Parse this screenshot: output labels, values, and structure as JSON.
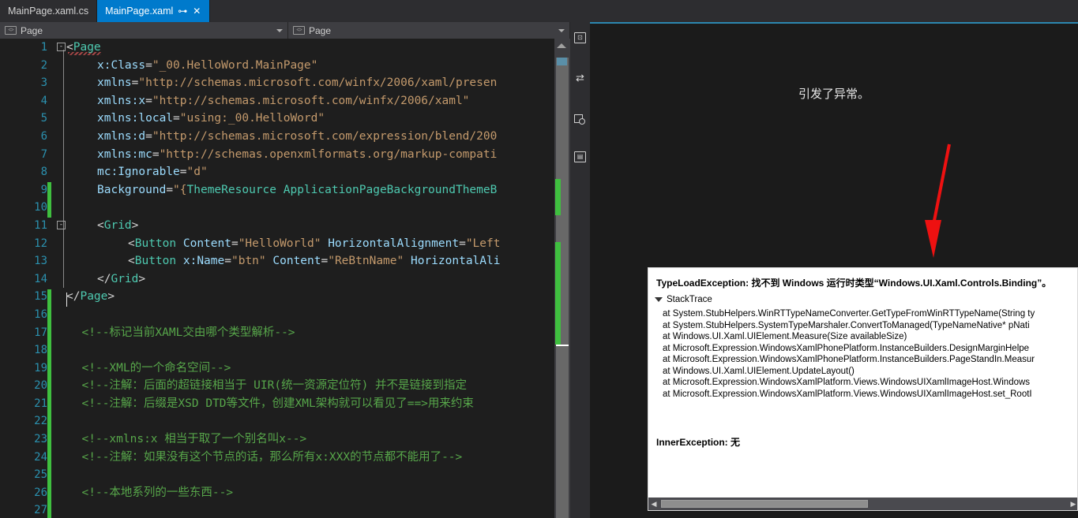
{
  "window": {
    "theme_bg": "#1e1e1e",
    "accent": "#007acc"
  },
  "tabs": [
    {
      "label": "MainPage.xaml.cs",
      "active": false
    },
    {
      "label": "MainPage.xaml",
      "active": true,
      "pin_icon": "pin-icon",
      "close_icon": "close-icon"
    }
  ],
  "dropdowns": {
    "left": {
      "label": "Page",
      "icon": "code-tag-icon"
    },
    "right": {
      "label": "Page",
      "icon": "code-tag-icon"
    }
  },
  "designer_tools": [
    {
      "name": "zoom-fit-icon",
      "glyph": "⊡"
    },
    {
      "name": "swap-panes-icon",
      "glyph": "⇄"
    },
    {
      "name": "layers-icon",
      "glyph": ""
    },
    {
      "name": "document-outline-icon",
      "glyph": "≡"
    }
  ],
  "editor": {
    "lines": [
      {
        "n": 1,
        "fold": "-",
        "indent": 0,
        "tokens": [
          {
            "t": "<",
            "c": "pun"
          },
          {
            "t": "Page",
            "c": "el"
          }
        ]
      },
      {
        "n": 2,
        "indent": 2,
        "tokens": [
          {
            "t": "x:Class",
            "c": "attr"
          },
          {
            "t": "=",
            "c": "pun"
          },
          {
            "t": "\"_00.HelloWord.MainPage\"",
            "c": "val"
          }
        ]
      },
      {
        "n": 3,
        "indent": 2,
        "tokens": [
          {
            "t": "xmlns",
            "c": "attr"
          },
          {
            "t": "=",
            "c": "pun"
          },
          {
            "t": "\"http://schemas.microsoft.com/winfx/2006/xaml/presen",
            "c": "val"
          }
        ]
      },
      {
        "n": 4,
        "indent": 2,
        "tokens": [
          {
            "t": "xmlns:x",
            "c": "attr"
          },
          {
            "t": "=",
            "c": "pun"
          },
          {
            "t": "\"http://schemas.microsoft.com/winfx/2006/xaml\"",
            "c": "val"
          }
        ]
      },
      {
        "n": 5,
        "indent": 2,
        "tokens": [
          {
            "t": "xmlns:local",
            "c": "attr"
          },
          {
            "t": "=",
            "c": "pun"
          },
          {
            "t": "\"using:_00.HelloWord\"",
            "c": "val"
          }
        ]
      },
      {
        "n": 6,
        "indent": 2,
        "tokens": [
          {
            "t": "xmlns:d",
            "c": "attr"
          },
          {
            "t": "=",
            "c": "pun"
          },
          {
            "t": "\"http://schemas.microsoft.com/expression/blend/200",
            "c": "val"
          }
        ]
      },
      {
        "n": 7,
        "indent": 2,
        "tokens": [
          {
            "t": "xmlns:mc",
            "c": "attr"
          },
          {
            "t": "=",
            "c": "pun"
          },
          {
            "t": "\"http://schemas.openxmlformats.org/markup-compati",
            "c": "val"
          }
        ]
      },
      {
        "n": 8,
        "indent": 2,
        "tokens": [
          {
            "t": "mc:Ignorable",
            "c": "attr"
          },
          {
            "t": "=",
            "c": "pun"
          },
          {
            "t": "\"d\"",
            "c": "val"
          }
        ]
      },
      {
        "n": 9,
        "indent": 2,
        "changed": true,
        "tokens": [
          {
            "t": "Background",
            "c": "attr"
          },
          {
            "t": "=",
            "c": "pun"
          },
          {
            "t": "\"{",
            "c": "val"
          },
          {
            "t": "ThemeResource ApplicationPageBackgroundThemeB",
            "c": "el"
          }
        ]
      },
      {
        "n": 10,
        "indent": 0,
        "changed": true,
        "tokens": []
      },
      {
        "n": 11,
        "fold": "-",
        "indent": 2,
        "tokens": [
          {
            "t": "<",
            "c": "pun"
          },
          {
            "t": "Grid",
            "c": "el"
          },
          {
            "t": ">",
            "c": "pun"
          }
        ]
      },
      {
        "n": 12,
        "indent": 4,
        "tokens": [
          {
            "t": "<",
            "c": "pun"
          },
          {
            "t": "Button",
            "c": "el"
          },
          {
            "t": " ",
            "c": "pun"
          },
          {
            "t": "Content",
            "c": "attr"
          },
          {
            "t": "=",
            "c": "pun"
          },
          {
            "t": "\"HelloWorld\"",
            "c": "val"
          },
          {
            "t": " ",
            "c": "pun"
          },
          {
            "t": "HorizontalAlignment",
            "c": "attr"
          },
          {
            "t": "=",
            "c": "pun"
          },
          {
            "t": "\"Left",
            "c": "val"
          }
        ]
      },
      {
        "n": 13,
        "indent": 4,
        "tokens": [
          {
            "t": "<",
            "c": "pun"
          },
          {
            "t": "Button",
            "c": "el"
          },
          {
            "t": " ",
            "c": "pun"
          },
          {
            "t": "x:Name",
            "c": "attr"
          },
          {
            "t": "=",
            "c": "pun"
          },
          {
            "t": "\"btn\"",
            "c": "val"
          },
          {
            "t": " ",
            "c": "pun"
          },
          {
            "t": "Content",
            "c": "attr"
          },
          {
            "t": "=",
            "c": "pun"
          },
          {
            "t": "\"ReBtnName\"",
            "c": "val"
          },
          {
            "t": " ",
            "c": "pun"
          },
          {
            "t": "HorizontalAli",
            "c": "attr"
          }
        ]
      },
      {
        "n": 14,
        "indent": 2,
        "tokens": [
          {
            "t": "</",
            "c": "pun"
          },
          {
            "t": "Grid",
            "c": "el"
          },
          {
            "t": ">",
            "c": "pun"
          }
        ]
      },
      {
        "n": 15,
        "indent": 0,
        "changed": true,
        "caret": true,
        "tokens": [
          {
            "t": "</",
            "c": "pun"
          },
          {
            "t": "Page",
            "c": "el"
          },
          {
            "t": ">",
            "c": "pun"
          }
        ]
      },
      {
        "n": 16,
        "indent": 0,
        "changed": true,
        "tokens": []
      },
      {
        "n": 17,
        "indent": 1,
        "changed": true,
        "tokens": [
          {
            "t": "<!--标记当前XAML交由哪个类型解析-->",
            "c": "cmt"
          }
        ]
      },
      {
        "n": 18,
        "indent": 0,
        "changed": true,
        "tokens": []
      },
      {
        "n": 19,
        "indent": 1,
        "changed": true,
        "tokens": [
          {
            "t": "<!--XML的一个命名空间-->",
            "c": "cmt"
          }
        ]
      },
      {
        "n": 20,
        "indent": 1,
        "changed": true,
        "tokens": [
          {
            "t": "<!--注解：后面的超链接相当于 UIR(统一资源定位符) 并不是链接到指定",
            "c": "cmt"
          }
        ]
      },
      {
        "n": 21,
        "indent": 1,
        "changed": true,
        "tokens": [
          {
            "t": "<!--注解：后缀是XSD DTD等文件，创建XML架构就可以看见了==>用来约束",
            "c": "cmt"
          }
        ]
      },
      {
        "n": 22,
        "indent": 0,
        "changed": true,
        "tokens": []
      },
      {
        "n": 23,
        "indent": 1,
        "changed": true,
        "tokens": [
          {
            "t": "<!--xmlns:x 相当于取了一个别名叫x-->",
            "c": "cmt"
          }
        ]
      },
      {
        "n": 24,
        "indent": 1,
        "changed": true,
        "tokens": [
          {
            "t": "<!--注解：如果没有这个节点的话，那么所有x:XXX的节点都不能用了-->",
            "c": "cmt"
          }
        ]
      },
      {
        "n": 25,
        "indent": 0,
        "changed": true,
        "tokens": []
      },
      {
        "n": 26,
        "indent": 1,
        "changed": true,
        "tokens": [
          {
            "t": "<!--本地系列的一些东西-->",
            "c": "cmt"
          }
        ]
      },
      {
        "n": 27,
        "indent": 0,
        "changed": true,
        "tokens": []
      }
    ]
  },
  "designer": {
    "title": "引发了异常。",
    "exception": {
      "header": "TypeLoadException: 找不到 Windows 运行时类型“Windows.UI.Xaml.Controls.Binding”。",
      "section_label": "StackTrace",
      "stack": [
        "at System.StubHelpers.WinRTTypeNameConverter.GetTypeFromWinRTTypeName(String ty",
        "at System.StubHelpers.SystemTypeMarshaler.ConvertToManaged(TypeNameNative* pNati",
        "at Windows.UI.Xaml.UIElement.Measure(Size availableSize)",
        "at Microsoft.Expression.WindowsXamlPhonePlatform.InstanceBuilders.DesignMarginHelpe",
        "at Microsoft.Expression.WindowsXamlPhonePlatform.InstanceBuilders.PageStandIn.Measur",
        "at Windows.UI.Xaml.UIElement.UpdateLayout()",
        "at Microsoft.Expression.WindowsXamlPlatform.Views.WindowsUIXamlImageHost.Windows",
        "at Microsoft.Expression.WindowsXamlPlatform.Views.WindowsUIXamlImageHost.set_RootI"
      ],
      "inner_label": "InnerException:",
      "inner_value": "无"
    },
    "hscroll": {
      "left_icon": "scroll-left-icon",
      "right_icon": "scroll-right-icon"
    }
  },
  "annotation": {
    "arrow_color": "#ee1111",
    "name": "red-arrow-annotation"
  }
}
